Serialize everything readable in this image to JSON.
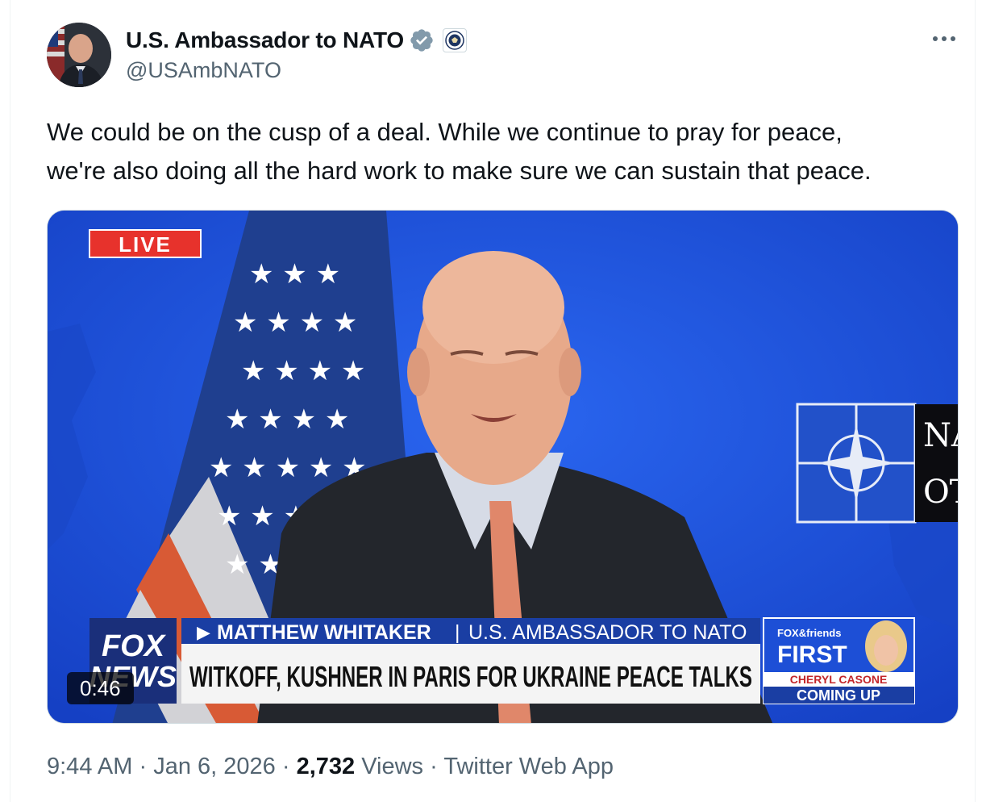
{
  "author": {
    "display_name": "U.S. Ambassador to NATO",
    "handle": "@USAmbNATO",
    "verified_icon": "verified-badge-icon",
    "affiliation_icon": "state-department-seal-icon"
  },
  "tweet": {
    "text_line1": "We could be on the cusp of a deal. While we continue to pray for peace,",
    "text_line2": "we're also doing all the hard work to make sure we can sustain that peace."
  },
  "video": {
    "duration": "0:46",
    "live_label": "LIVE",
    "chyron_name": "MATTHEW WHITAKER",
    "chyron_title": "U.S. AMBASSADOR TO NATO",
    "headline": "WITKOFF, KUSHNER IN PARIS FOR UKRAINE PEACE TALKS",
    "network_logo_line1": "FOX",
    "network_logo_line2": "NEWS",
    "promo_brand": "FOX&friends",
    "promo_show": "FIRST",
    "promo_host": "CHERYL CASONE",
    "promo_status": "COMING UP",
    "nato_sign_top": "NA",
    "nato_sign_bottom": "OT"
  },
  "meta": {
    "time": "9:44 AM",
    "date": "Jan 6, 2026",
    "views_count": "2,732",
    "views_label": "Views",
    "source": "Twitter Web App",
    "separator": "·"
  },
  "colors": {
    "text_primary": "#0f1419",
    "text_secondary": "#536471",
    "verified_blue": "#829aab",
    "video_backdrop": "#1d4fd6"
  }
}
